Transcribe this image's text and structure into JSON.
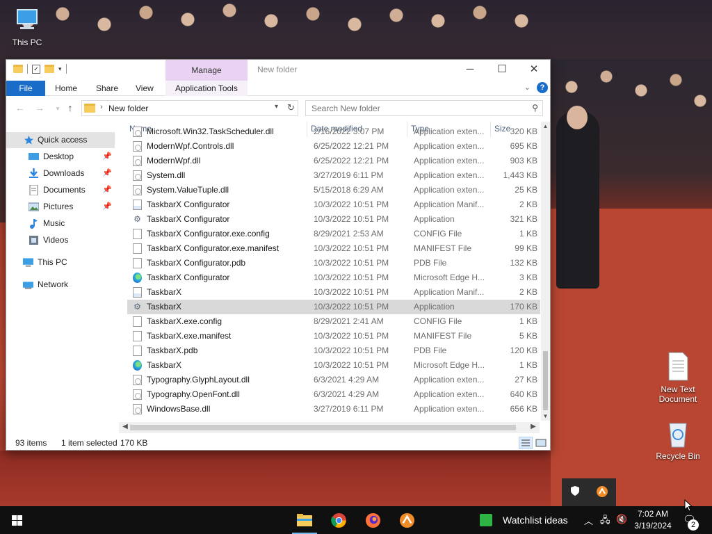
{
  "desktop": {
    "icons": {
      "this_pc": "This PC",
      "new_text_doc": "New Text Document",
      "recycle_bin": "Recycle Bin"
    }
  },
  "window": {
    "title": "New folder",
    "manage_tab": "Manage",
    "ribbon": {
      "file": "File",
      "home": "Home",
      "share": "Share",
      "view": "View",
      "app_tools": "Application Tools"
    },
    "address": {
      "path": "New folder"
    },
    "search": {
      "placeholder": "Search New folder"
    },
    "nav_pane": {
      "quick_access": "Quick access",
      "desktop": "Desktop",
      "downloads": "Downloads",
      "documents": "Documents",
      "pictures": "Pictures",
      "music": "Music",
      "videos": "Videos",
      "this_pc": "This PC",
      "network": "Network"
    },
    "columns": {
      "name": "Name",
      "date": "Date modified",
      "type": "Type",
      "size": "Size"
    },
    "files": [
      {
        "name": "Microsoft.Win32.TaskScheduler.dll",
        "date": "2/16/2022 3:07 PM",
        "type": "Application exten...",
        "size": "320 KB",
        "icon": "dll"
      },
      {
        "name": "ModernWpf.Controls.dll",
        "date": "6/25/2022 12:21 PM",
        "type": "Application exten...",
        "size": "695 KB",
        "icon": "dll"
      },
      {
        "name": "ModernWpf.dll",
        "date": "6/25/2022 12:21 PM",
        "type": "Application exten...",
        "size": "903 KB",
        "icon": "dll"
      },
      {
        "name": "System.dll",
        "date": "3/27/2019 6:11 PM",
        "type": "Application exten...",
        "size": "1,443 KB",
        "icon": "dll"
      },
      {
        "name": "System.ValueTuple.dll",
        "date": "5/15/2018 6:29 AM",
        "type": "Application exten...",
        "size": "25 KB",
        "icon": "dll"
      },
      {
        "name": "TaskbarX Configurator",
        "date": "10/3/2022 10:51 PM",
        "type": "Application Manif...",
        "size": "2 KB",
        "icon": "manifest"
      },
      {
        "name": "TaskbarX Configurator",
        "date": "10/3/2022 10:51 PM",
        "type": "Application",
        "size": "321 KB",
        "icon": "app"
      },
      {
        "name": "TaskbarX Configurator.exe.config",
        "date": "8/29/2021 2:53 AM",
        "type": "CONFIG File",
        "size": "1 KB",
        "icon": "doc"
      },
      {
        "name": "TaskbarX Configurator.exe.manifest",
        "date": "10/3/2022 10:51 PM",
        "type": "MANIFEST File",
        "size": "99 KB",
        "icon": "doc"
      },
      {
        "name": "TaskbarX Configurator.pdb",
        "date": "10/3/2022 10:51 PM",
        "type": "PDB File",
        "size": "132 KB",
        "icon": "doc"
      },
      {
        "name": "TaskbarX Configurator",
        "date": "10/3/2022 10:51 PM",
        "type": "Microsoft Edge H...",
        "size": "3 KB",
        "icon": "edge"
      },
      {
        "name": "TaskbarX",
        "date": "10/3/2022 10:51 PM",
        "type": "Application Manif...",
        "size": "2 KB",
        "icon": "manifest"
      },
      {
        "name": "TaskbarX",
        "date": "10/3/2022 10:51 PM",
        "type": "Application",
        "size": "170 KB",
        "icon": "app"
      },
      {
        "name": "TaskbarX.exe.config",
        "date": "8/29/2021 2:41 AM",
        "type": "CONFIG File",
        "size": "1 KB",
        "icon": "doc"
      },
      {
        "name": "TaskbarX.exe.manifest",
        "date": "10/3/2022 10:51 PM",
        "type": "MANIFEST File",
        "size": "5 KB",
        "icon": "doc"
      },
      {
        "name": "TaskbarX.pdb",
        "date": "10/3/2022 10:51 PM",
        "type": "PDB File",
        "size": "120 KB",
        "icon": "doc"
      },
      {
        "name": "TaskbarX",
        "date": "10/3/2022 10:51 PM",
        "type": "Microsoft Edge H...",
        "size": "1 KB",
        "icon": "edge"
      },
      {
        "name": "Typography.GlyphLayout.dll",
        "date": "6/3/2021 4:29 AM",
        "type": "Application exten...",
        "size": "27 KB",
        "icon": "dll"
      },
      {
        "name": "Typography.OpenFont.dll",
        "date": "6/3/2021 4:29 AM",
        "type": "Application exten...",
        "size": "640 KB",
        "icon": "dll"
      },
      {
        "name": "WindowsBase.dll",
        "date": "3/27/2019 6:11 PM",
        "type": "Application exten...",
        "size": "656 KB",
        "icon": "dll"
      }
    ],
    "selected_row_index": 12,
    "status": {
      "item_count": "93 items",
      "selection": "1 item selected",
      "selection_size": "170 KB"
    }
  },
  "taskbar": {
    "news_text": "Watchlist ideas",
    "time": "7:02 AM",
    "date": "3/19/2024",
    "notification_count": "2"
  },
  "colors": {
    "accent": "#1a6cc9",
    "manage_tab": "#e9d2f2",
    "selection": "#d9d9d9"
  }
}
